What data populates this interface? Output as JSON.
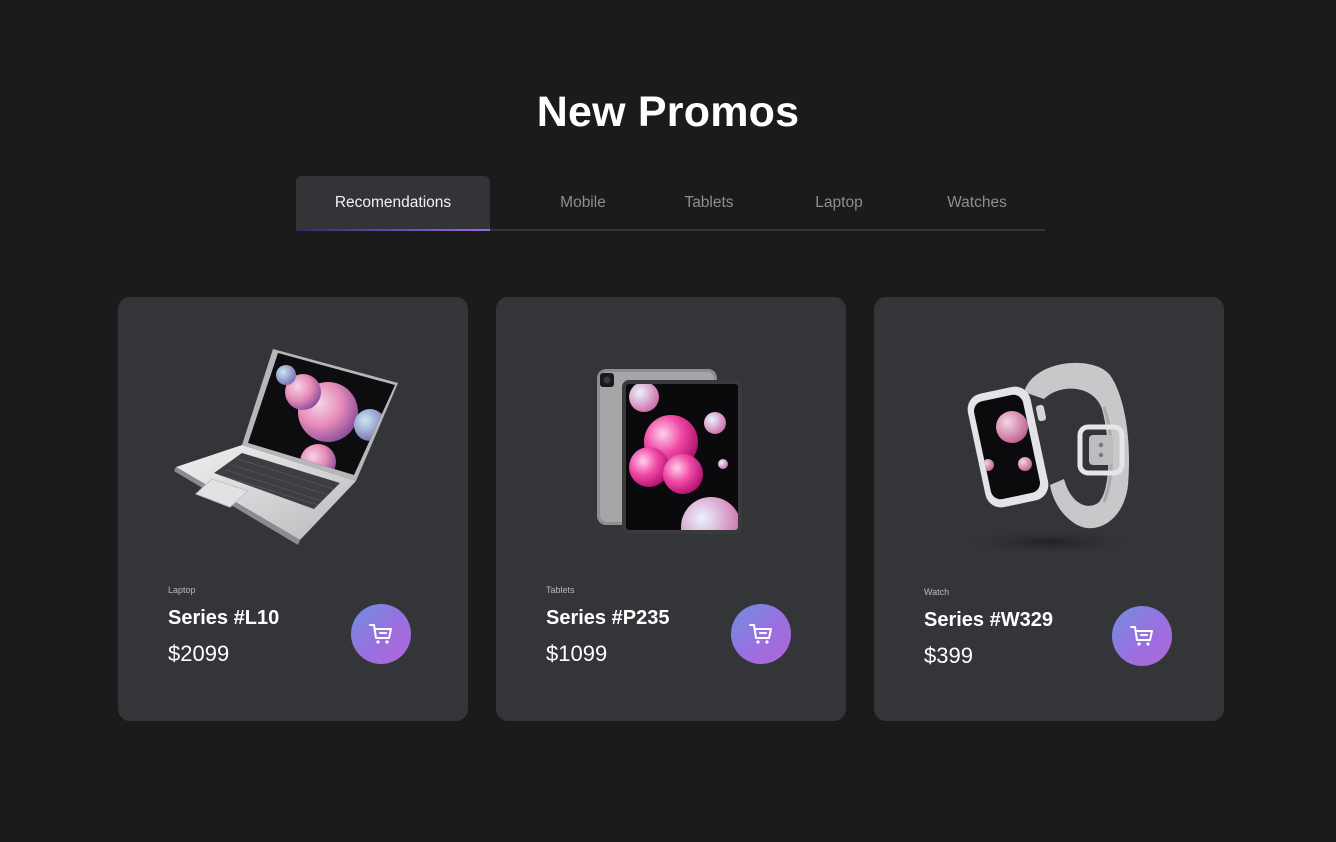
{
  "page": {
    "title": "New Promos"
  },
  "tabs": [
    {
      "label": "Recomendations",
      "active": true
    },
    {
      "label": "Mobile",
      "active": false
    },
    {
      "label": "Tablets",
      "active": false
    },
    {
      "label": "Laptop",
      "active": false
    },
    {
      "label": "Watches",
      "active": false
    }
  ],
  "products": [
    {
      "category": "Laptop",
      "name": "Series #L10",
      "price": "$2099",
      "image": "laptop"
    },
    {
      "category": "Tablets",
      "name": "Series #P235",
      "price": "$1099",
      "image": "tablet"
    },
    {
      "category": "Watch",
      "name": "Series #W329",
      "price": "$399",
      "image": "smartwatch"
    }
  ],
  "icons": {
    "cart": "cart-icon"
  },
  "colors": {
    "background": "#1b1b1c",
    "card": "#343539",
    "accent_start": "#6f8fe0",
    "accent_end": "#b266d8"
  }
}
